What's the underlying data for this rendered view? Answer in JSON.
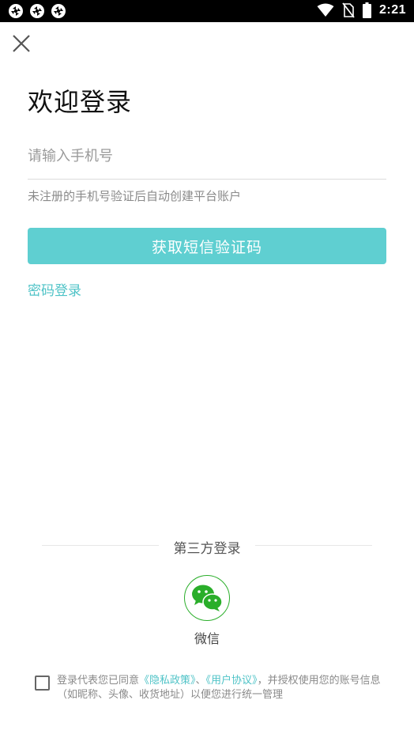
{
  "status_bar": {
    "time": "2:21",
    "icons": [
      "app-notification-icon",
      "app-notification-icon",
      "app-notification-icon",
      "wifi-icon",
      "no-sim-icon",
      "battery-icon"
    ]
  },
  "header": {
    "close_icon": "close-icon"
  },
  "main": {
    "title": "欢迎登录",
    "phone_placeholder": "请输入手机号",
    "phone_value": "",
    "hint": "未注册的手机号验证后自动创建平台账户",
    "sms_button_label": "获取短信验证码",
    "password_login_label": "密码登录"
  },
  "third_party": {
    "title": "第三方登录",
    "wechat_label": "微信"
  },
  "agreement": {
    "checked": false,
    "text_before": "登录代表您已同意",
    "privacy_link": "《隐私政策》",
    "separator": "、",
    "user_agreement_link": "《用户协议》",
    "text_after": "，并授权使用您的账号信息（如昵称、头像、收货地址）以便您进行统一管理"
  },
  "colors": {
    "accent": "#5fcfd1",
    "link": "#4fc3c7",
    "wechat_green": "#2aae2a",
    "status_bar_bg": "#000000"
  }
}
